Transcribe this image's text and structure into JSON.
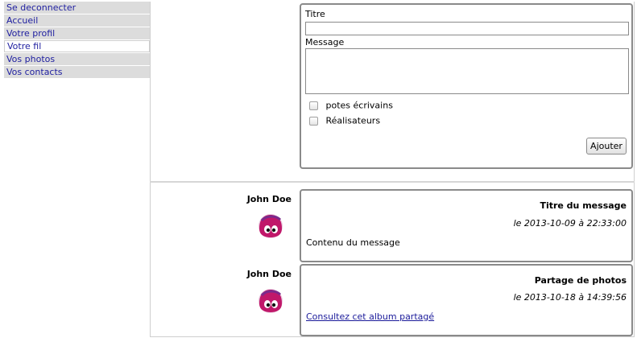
{
  "nav": {
    "items": [
      {
        "label": "Se deconnecter"
      },
      {
        "label": "Accueil"
      },
      {
        "label": "Votre profil"
      },
      {
        "label": "Votre fil"
      },
      {
        "label": "Vos photos"
      },
      {
        "label": "Vos contacts"
      }
    ],
    "active_item": "Votre fil"
  },
  "form": {
    "title_label": "Titre",
    "title_value": "",
    "message_label": "Message",
    "message_value": "",
    "groups": [
      {
        "label": "potes écrivains",
        "checked": false
      },
      {
        "label": "Réalisateurs",
        "checked": false
      }
    ],
    "submit_label": "Ajouter"
  },
  "posts": [
    {
      "author": "John Doe",
      "avatar_icon": "pink-blob-avatar-icon",
      "title": "Titre du message",
      "date": "le 2013-10-09 à 22:33:00",
      "body": "Contenu du message"
    },
    {
      "author": "John Doe",
      "avatar_icon": "pink-blob-avatar-icon",
      "title": "Partage de photos",
      "date": "le 2013-10-18 à 14:39:56",
      "link": "Consultez cet album partagé"
    }
  ],
  "colors": {
    "nav_bg": "#dcdcdc",
    "nav_link": "#2020a0",
    "panel_border": "#8a8a8a",
    "avatar_pink": "#c0186a"
  }
}
